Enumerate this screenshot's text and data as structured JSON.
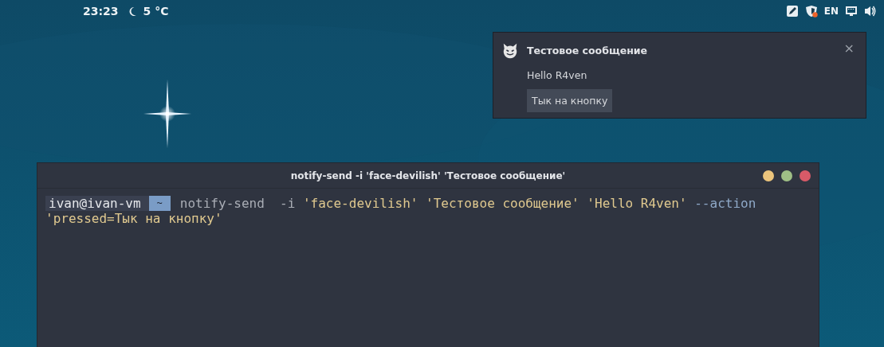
{
  "top_bar": {
    "clock": "23:23",
    "weather": "5 °C",
    "tray": [
      {
        "kind": "pen"
      },
      {
        "kind": "shield"
      },
      {
        "kind": "text",
        "label": "EN"
      },
      {
        "kind": "network"
      },
      {
        "kind": "volume"
      }
    ]
  },
  "notification": {
    "title": "Тестовое сообщение",
    "body": "Hello R4ven",
    "action": "Тык на кнопку",
    "close": "×"
  },
  "terminal": {
    "title": "notify-send -i 'face-devilish' 'Тестовое сообщение'",
    "prompt": {
      "user_host": "ivan@ivan-vm",
      "path": "~"
    },
    "lines": [
      {
        "tokens": [
          {
            "text": "notify-send  -i ",
            "kind": "plain"
          },
          {
            "text": "'face-devilish' 'Тестовое сообщение' 'Hello R4ven'",
            "kind": "string"
          },
          {
            "text": " --action",
            "kind": "option"
          }
        ]
      },
      {
        "tokens": [
          {
            "text": "'pressed=Тык на кнопку'",
            "kind": "string"
          }
        ]
      }
    ]
  }
}
